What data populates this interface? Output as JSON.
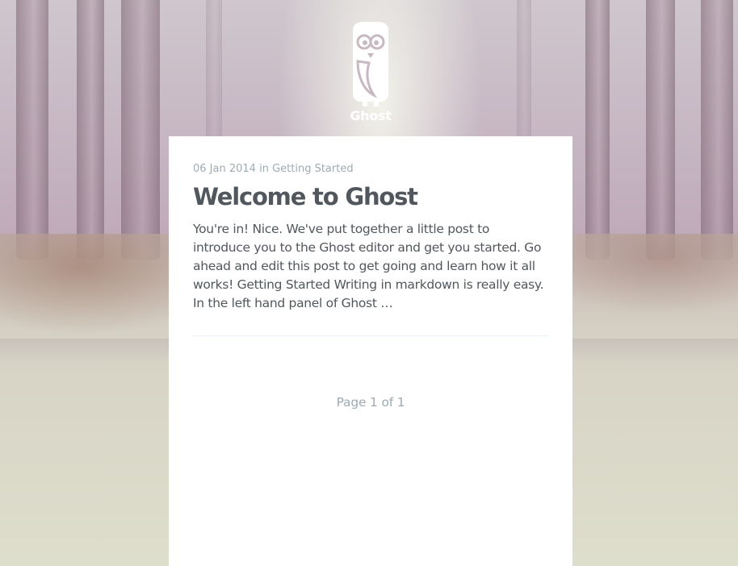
{
  "header": {
    "blog_title": "Ghost",
    "logo_icon": "ghost-owl-logo-icon"
  },
  "post": {
    "date": "06 Jan 2014",
    "in_word": "in",
    "tag": "Getting Started",
    "title": "Welcome to Ghost",
    "excerpt_lines": [
      "You're in! Nice. We've put together a little post to",
      "introduce you to the Ghost editor and get you started. Go",
      "ahead and edit this post to get going and learn how it all",
      "works! Getting Started Writing in markdown is really easy.",
      "In the left hand panel of Ghost …"
    ]
  },
  "pagination": {
    "text": "Page 1 of 1"
  },
  "colors": {
    "panel": "#ffffff",
    "meta": "#9eabb3",
    "text": "#50585d"
  }
}
